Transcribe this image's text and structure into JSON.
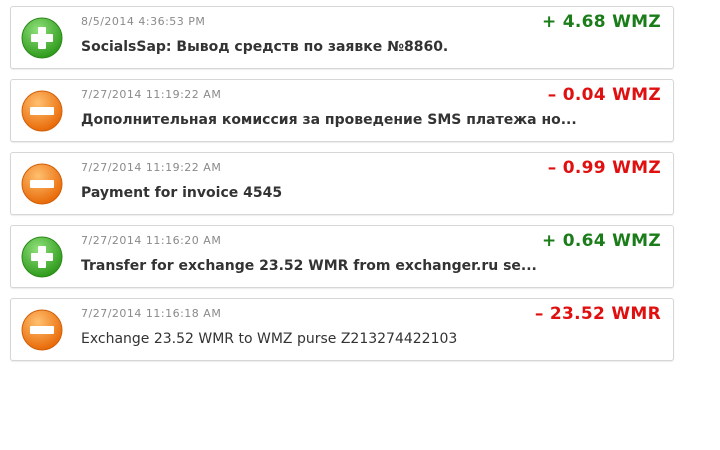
{
  "transactions": [
    {
      "type": "income",
      "icon": "plus-icon",
      "date": "8/5/2014 4:36:53 PM",
      "description": "SocialsSap: Вывод средств по заявке №8860.",
      "amount": "+ 4.68 WMZ",
      "bold": true
    },
    {
      "type": "expense",
      "icon": "minus-icon",
      "date": "7/27/2014 11:19:22 AM",
      "description": "Дополнительная комиссия за проведение SMS платежа но...",
      "amount": "– 0.04 WMZ",
      "bold": true
    },
    {
      "type": "expense",
      "icon": "minus-icon",
      "date": "7/27/2014 11:19:22 AM",
      "description": "Payment for invoice 4545",
      "amount": "– 0.99 WMZ",
      "bold": true
    },
    {
      "type": "income",
      "icon": "plus-icon",
      "date": "7/27/2014 11:16:20 AM",
      "description": "Transfer for exchange 23.52 WMR from exchanger.ru se...",
      "amount": "+ 0.64 WMZ",
      "bold": true
    },
    {
      "type": "expense",
      "icon": "minus-icon",
      "date": "7/27/2014 11:16:18 AM",
      "description": "Exchange 23.52 WMR to WMZ purse Z213274422103",
      "amount": "– 23.52 WMR",
      "bold": false
    }
  ],
  "colors": {
    "income": "#1a7d1a",
    "expense": "#e01010",
    "plus_icon": "#4cb030",
    "minus_icon": "#f07c12"
  }
}
